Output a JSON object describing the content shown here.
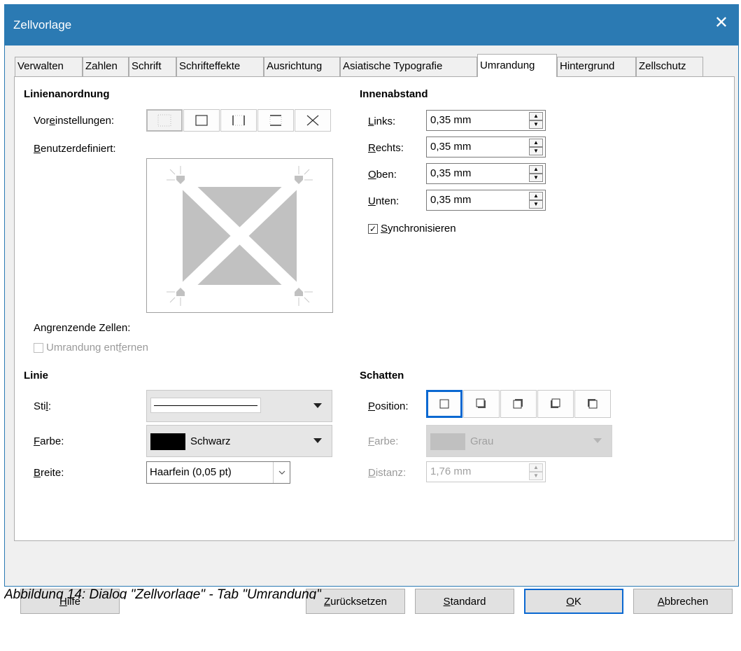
{
  "window": {
    "title": "Zellvorlage",
    "close_glyph": "✕"
  },
  "tabs": [
    {
      "label": "Verwalten"
    },
    {
      "label": "Zahlen"
    },
    {
      "label": "Schrift"
    },
    {
      "label": "Schrifteffekte"
    },
    {
      "label": "Ausrichtung"
    },
    {
      "label": "Asiatische Typografie"
    },
    {
      "label": "Umrandung",
      "active": true
    },
    {
      "label": "Hintergrund"
    },
    {
      "label": "Zellschutz"
    }
  ],
  "line_arrangement": {
    "title": "Linienanordnung",
    "presets_label_pre": "Vor",
    "presets_label_u": "e",
    "presets_label_post": "instellungen:",
    "user_defined_pre": "",
    "user_defined_u": "B",
    "user_defined_post": "enutzerdefiniert:",
    "adjacent_pre": "An",
    "adjacent_u": "g",
    "adjacent_post": "renzende Zellen:",
    "remove_border_pre": "Umrandung ent",
    "remove_border_u": "f",
    "remove_border_post": "ernen",
    "remove_border_checked": false
  },
  "padding": {
    "title": "Innenabstand",
    "rows": [
      {
        "u": "L",
        "rest": "inks:",
        "value": "0,35 mm"
      },
      {
        "u": "R",
        "rest": "echts:",
        "value": "0,35 mm"
      },
      {
        "u": "O",
        "rest": "ben:",
        "value": "0,35 mm"
      },
      {
        "u": "U",
        "rest": "nten:",
        "value": "0,35 mm"
      }
    ],
    "sync_u": "S",
    "sync_rest": "ynchronisieren",
    "sync_checked": true,
    "check_glyph": "✓"
  },
  "line": {
    "title": "Linie",
    "style_pre": "Sti",
    "style_u": "l",
    "style_post": ":",
    "color_u": "F",
    "color_rest": "arbe:",
    "color_value": "Schwarz",
    "color_swatch": "#000000",
    "width_u": "B",
    "width_rest": "reite:",
    "width_value": "Haarfein (0,05 pt)"
  },
  "shadow": {
    "title": "Schatten",
    "position_u": "P",
    "position_rest": "osition:",
    "color_u": "F",
    "color_rest": "arbe:",
    "color_value": "Grau",
    "color_swatch": "#c0c0c0",
    "distance_u": "D",
    "distance_rest": "istanz:",
    "distance_value": "1,76 mm"
  },
  "buttons": {
    "help_u": "H",
    "help_rest": "ilfe",
    "reset_u": "Z",
    "reset_rest": "urücksetzen",
    "standard_u": "S",
    "standard_rest": "tandard",
    "ok_u": "O",
    "ok_rest": "K",
    "cancel_u": "A",
    "cancel_rest": "bbrechen"
  },
  "caption": "Abbildung 14: Dialog \"Zellvorlage\" - Tab \"Umrandung\"",
  "colors": {
    "titlebar": "#2b7ab3",
    "accent": "#0a68d1"
  }
}
